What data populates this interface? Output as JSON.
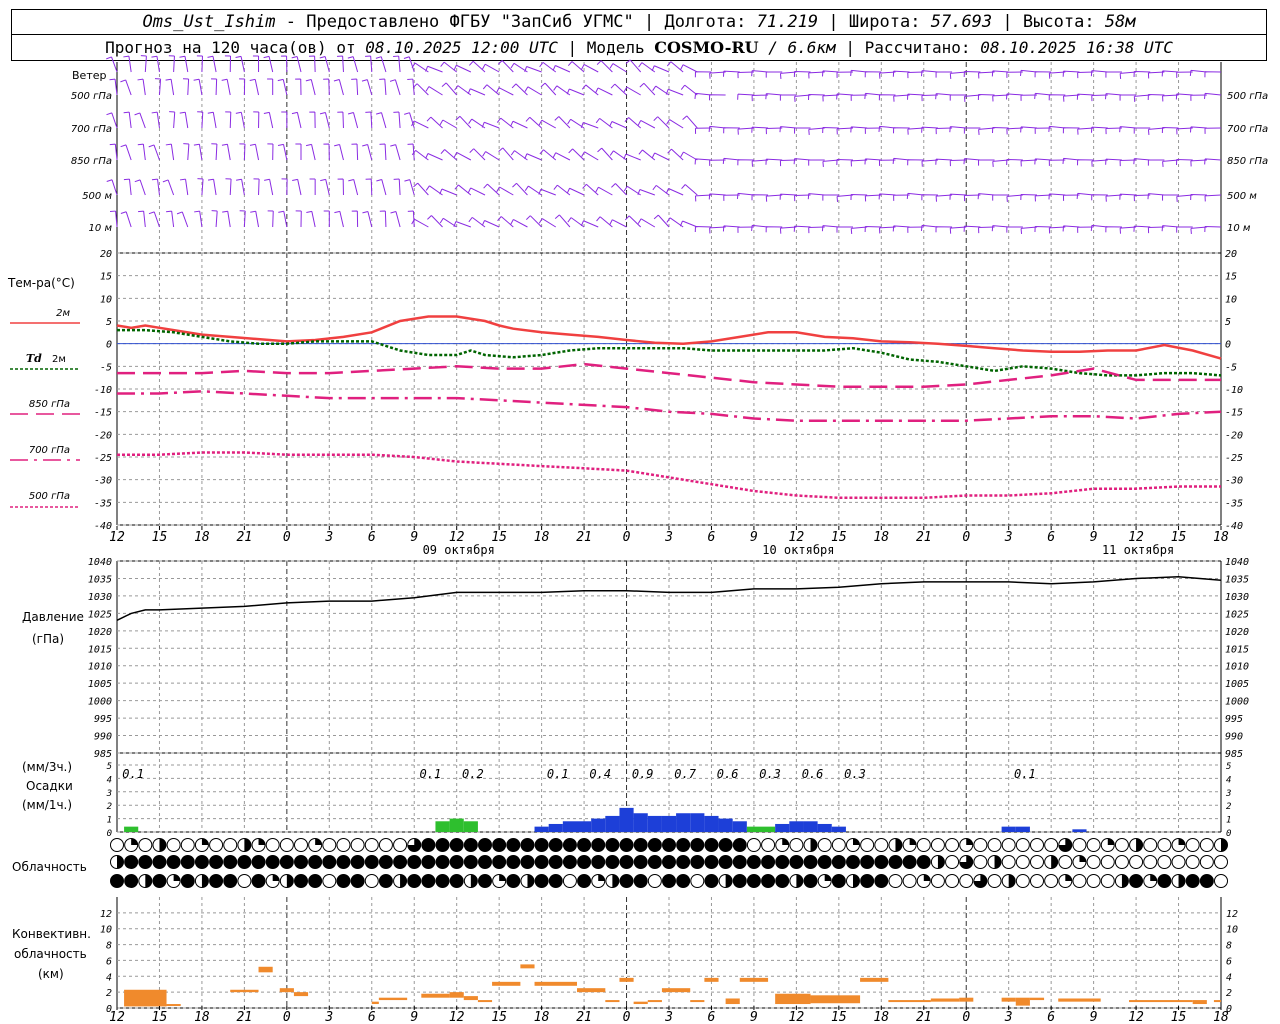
{
  "header": {
    "station": "Oms_Ust_Ishim",
    "provided_by": "- Предоставлено ФГБУ \"ЗапСиб УГМС\"",
    "lon_label": "Долгота:",
    "lon": "71.219",
    "lat_label": "Широта:",
    "lat": "57.693",
    "alt_label": "Высота:",
    "alt": "58м",
    "sep": "|",
    "forecast_label": "Прогноз на 120 часа(ов) от",
    "forecast_start": "08.10.2025 12:00 UTC",
    "model_label": "Модель",
    "model": "COSMO-RU",
    "model_res": "/ 6.6км",
    "calc_label": "Рассчитано:",
    "calc_time": "08.10.2025 16:38 UTC"
  },
  "colors": {
    "wind": "#8a2be2",
    "t2m": "#f04040",
    "td": "#006400",
    "t850": "#e0207f",
    "t700": "#e0207f",
    "t500": "#e0207f",
    "pressure": "#000000",
    "precip_rain": "#1d3fd8",
    "precip_light": "#2ebf2e",
    "convective": "#f08a2c",
    "zero_line": "#3050d0"
  },
  "chart_data": [
    {
      "type": "wind_barbs",
      "title": "Ветер",
      "levels": [
        "500 гПа",
        "700 гПа",
        "850 гПа",
        "500 м",
        "10 м"
      ],
      "x_ticks": [
        "12",
        "15",
        "18",
        "21",
        "0",
        "3",
        "6",
        "9",
        "12",
        "15",
        "18",
        "21",
        "0",
        "3",
        "6",
        "9",
        "12",
        "15",
        "18",
        "21",
        "0",
        "3",
        "6",
        "9",
        "12",
        "15",
        "18"
      ]
    },
    {
      "type": "line",
      "title": "Тем-ра(°С)",
      "ylim": [
        -40,
        20
      ],
      "yticks": [
        20,
        15,
        10,
        5,
        0,
        -5,
        -10,
        -15,
        -20,
        -25,
        -30,
        -35,
        -40
      ],
      "x_hours": [
        0,
        3,
        6,
        9,
        12,
        15,
        18,
        21,
        24,
        27,
        30,
        33,
        36,
        39,
        42,
        45,
        48,
        51,
        54,
        57,
        60,
        63,
        66,
        69,
        72,
        75,
        78
      ],
      "x_ticks": [
        "12",
        "15",
        "18",
        "21",
        "0",
        "3",
        "6",
        "9",
        "12",
        "15",
        "18",
        "21",
        "0",
        "3",
        "6",
        "9",
        "12",
        "15",
        "18",
        "21",
        "0",
        "3",
        "6",
        "9",
        "12",
        "15",
        "18"
      ],
      "day_labels": [
        {
          "hour": 24,
          "text": "09 октября"
        },
        {
          "hour": 48,
          "text": "10 октября"
        },
        {
          "hour": 72,
          "text": "11 октября"
        }
      ],
      "series": [
        {
          "name": "2м",
          "key": "t2m",
          "x": [
            0,
            1,
            2,
            3,
            4,
            6,
            8,
            10,
            12,
            14,
            16,
            18,
            20,
            22,
            24,
            26,
            27,
            28,
            30,
            32,
            34,
            36,
            38,
            40,
            42,
            44,
            46,
            48,
            50,
            52,
            54,
            56,
            58,
            60,
            62,
            64,
            66,
            68,
            70,
            72,
            74,
            76,
            78
          ],
          "values": [
            4,
            3.5,
            4,
            3.5,
            3,
            2,
            1.5,
            1,
            0.5,
            0.8,
            1.5,
            2.5,
            5,
            6,
            6,
            5,
            4,
            3.3,
            2.5,
            2.0,
            1.5,
            0.8,
            0.2,
            0,
            0.5,
            1.5,
            2.5,
            2.5,
            1.5,
            1.2,
            0.5,
            0.3,
            0,
            -0.5,
            -1,
            -1.5,
            -1.8,
            -1.8,
            -1.5,
            -1.5,
            -0.3,
            -1.5,
            -3.3
          ]
        },
        {
          "name": "Td  2м",
          "key": "td",
          "x": [
            0,
            2,
            4,
            6,
            8,
            10,
            12,
            14,
            16,
            18,
            20,
            22,
            24,
            25,
            26,
            28,
            30,
            32,
            34,
            36,
            38,
            40,
            42,
            44,
            46,
            48,
            50,
            52,
            54,
            56,
            58,
            60,
            62,
            64,
            66,
            68,
            70,
            72,
            74,
            76,
            78
          ],
          "values": [
            3,
            3,
            2.5,
            1.5,
            0.5,
            0,
            0,
            0.5,
            0.5,
            0.5,
            -1.5,
            -2.5,
            -2.5,
            -1.5,
            -2.5,
            -3,
            -2.5,
            -1.5,
            -1,
            -1,
            -1,
            -1,
            -1.5,
            -1.5,
            -1.5,
            -1.5,
            -1.5,
            -1,
            -2,
            -3.5,
            -4,
            -5,
            -6,
            -5,
            -5.5,
            -6.5,
            -7,
            -7,
            -6.5,
            -6.5,
            -7
          ]
        },
        {
          "name": "850 гПа",
          "key": "t850",
          "x": [
            0,
            3,
            6,
            9,
            12,
            15,
            18,
            21,
            24,
            27,
            30,
            33,
            36,
            39,
            42,
            45,
            48,
            51,
            54,
            57,
            60,
            63,
            66,
            69,
            72,
            75,
            78
          ],
          "values": [
            -6.5,
            -6.5,
            -6.5,
            -6,
            -6.5,
            -6.5,
            -6,
            -5.5,
            -5,
            -5.5,
            -5.5,
            -4.5,
            -5.5,
            -6.5,
            -7.5,
            -8.5,
            -9,
            -9.5,
            -9.5,
            -9.5,
            -9,
            -8,
            -7,
            -5.5,
            -8,
            -8,
            -8
          ]
        },
        {
          "name": "700 гПа",
          "key": "t700",
          "x": [
            0,
            3,
            6,
            9,
            12,
            15,
            18,
            21,
            24,
            27,
            30,
            33,
            36,
            39,
            42,
            45,
            48,
            51,
            54,
            57,
            60,
            63,
            66,
            69,
            72,
            75,
            78
          ],
          "values": [
            -11,
            -11,
            -10.5,
            -11,
            -11.5,
            -12,
            -12,
            -12,
            -12,
            -12.5,
            -13,
            -13.5,
            -14,
            -15,
            -15.5,
            -16.5,
            -17,
            -17,
            -17,
            -17,
            -17,
            -16.5,
            -16,
            -16,
            -16.5,
            -15.5,
            -15
          ]
        },
        {
          "name": "500 гПа",
          "key": "t500",
          "x": [
            0,
            3,
            6,
            9,
            12,
            15,
            18,
            21,
            24,
            27,
            30,
            33,
            36,
            39,
            42,
            45,
            48,
            51,
            54,
            57,
            60,
            63,
            66,
            69,
            72,
            75,
            78
          ],
          "values": [
            -24.5,
            -24.5,
            -24,
            -24,
            -24.5,
            -24.5,
            -24.5,
            -25,
            -26,
            -26.5,
            -27,
            -27.5,
            -28,
            -29.5,
            -31,
            -32.5,
            -33.5,
            -34,
            -34,
            -34,
            -33.5,
            -33.5,
            -33,
            -32,
            -32,
            -31.5,
            -31.5
          ]
        }
      ]
    },
    {
      "type": "line",
      "title": "Давление",
      "unit": "(гПа)",
      "ylim": [
        985,
        1040
      ],
      "yticks": [
        1040,
        1035,
        1030,
        1025,
        1020,
        1015,
        1010,
        1005,
        1000,
        995,
        990,
        985
      ],
      "series": [
        {
          "key": "pressure",
          "x": [
            0,
            1,
            2,
            3,
            6,
            9,
            12,
            15,
            18,
            21,
            24,
            27,
            30,
            33,
            36,
            39,
            42,
            45,
            48,
            51,
            54,
            57,
            60,
            63,
            66,
            69,
            72,
            75,
            78
          ],
          "values": [
            1023,
            1025,
            1026,
            1026,
            1026.5,
            1027,
            1028,
            1028.5,
            1028.5,
            1029.5,
            1031,
            1031,
            1031,
            1031.5,
            1031.5,
            1031,
            1031,
            1032,
            1032,
            1032.5,
            1033.5,
            1034,
            1034,
            1034,
            1033.5,
            1034,
            1035,
            1035.5,
            1034.5
          ]
        }
      ]
    },
    {
      "type": "bar",
      "title": "Осадки",
      "unit_3h": "(мм/3ч.)",
      "unit_1h": "(мм/1ч.)",
      "ylim": [
        0,
        5
      ],
      "yticks": [
        5,
        4,
        3,
        2,
        1,
        0
      ],
      "totals_3h": [
        {
          "hour": 1,
          "text": "0.1"
        },
        {
          "hour": 22,
          "text": "0.1"
        },
        {
          "hour": 25,
          "text": "0.2"
        },
        {
          "hour": 31,
          "text": "0.1"
        },
        {
          "hour": 34,
          "text": "0.4"
        },
        {
          "hour": 37,
          "text": "0.9"
        },
        {
          "hour": 40,
          "text": "0.7"
        },
        {
          "hour": 43,
          "text": "0.6"
        },
        {
          "hour": 46,
          "text": "0.3"
        },
        {
          "hour": 49,
          "text": "0.6"
        },
        {
          "hour": 52,
          "text": "0.3"
        },
        {
          "hour": 64,
          "text": "0.1"
        }
      ],
      "hourly_light": [
        {
          "hour": 1,
          "value": 0.1
        },
        {
          "hour": 23,
          "value": 0.2
        },
        {
          "hour": 24,
          "value": 0.25
        },
        {
          "hour": 25,
          "value": 0.2
        },
        {
          "hour": 45,
          "value": 0.1
        },
        {
          "hour": 46,
          "value": 0.1
        }
      ],
      "hourly_rain": [
        {
          "hour": 30,
          "value": 0.1
        },
        {
          "hour": 31,
          "value": 0.15
        },
        {
          "hour": 32,
          "value": 0.2
        },
        {
          "hour": 33,
          "value": 0.2
        },
        {
          "hour": 34,
          "value": 0.25
        },
        {
          "hour": 35,
          "value": 0.3
        },
        {
          "hour": 36,
          "value": 0.45
        },
        {
          "hour": 37,
          "value": 0.35
        },
        {
          "hour": 38,
          "value": 0.3
        },
        {
          "hour": 39,
          "value": 0.3
        },
        {
          "hour": 40,
          "value": 0.35
        },
        {
          "hour": 41,
          "value": 0.35
        },
        {
          "hour": 42,
          "value": 0.3
        },
        {
          "hour": 43,
          "value": 0.25
        },
        {
          "hour": 44,
          "value": 0.2
        },
        {
          "hour": 47,
          "value": 0.15
        },
        {
          "hour": 48,
          "value": 0.2
        },
        {
          "hour": 49,
          "value": 0.2
        },
        {
          "hour": 50,
          "value": 0.15
        },
        {
          "hour": 51,
          "value": 0.1
        },
        {
          "hour": 63,
          "value": 0.1
        },
        {
          "hour": 64,
          "value": 0.1
        },
        {
          "hour": 68,
          "value": 0.05
        }
      ]
    },
    {
      "type": "table",
      "title": "Облачность",
      "rows": 3,
      "hourly_cover_description": "cloud cover symbols per hour, upper/middle/lower layers"
    },
    {
      "type": "bar",
      "title": "Конвективн. облачность",
      "unit": "(км)",
      "ylim": [
        0,
        14
      ],
      "yticks": [
        12,
        10,
        8,
        6,
        4,
        2,
        0
      ],
      "segments": [
        {
          "x0": 0.5,
          "x1": 3.5,
          "bottom": 0.2,
          "top": 2.3
        },
        {
          "x0": 3.5,
          "x1": 4.5,
          "bottom": 0.3,
          "top": 0.5
        },
        {
          "x0": 8,
          "x1": 10,
          "bottom": 2.0,
          "top": 2.3
        },
        {
          "x0": 10,
          "x1": 11,
          "bottom": 4.5,
          "top": 5.2
        },
        {
          "x0": 11.5,
          "x1": 12.5,
          "bottom": 2.0,
          "top": 2.5
        },
        {
          "x0": 12.5,
          "x1": 13.5,
          "bottom": 1.5,
          "top": 2.0
        },
        {
          "x0": 18,
          "x1": 18.5,
          "bottom": 0.5,
          "top": 0.8
        },
        {
          "x0": 18.5,
          "x1": 20.5,
          "bottom": 1.0,
          "top": 1.3
        },
        {
          "x0": 21.5,
          "x1": 23.5,
          "bottom": 1.3,
          "top": 1.8
        },
        {
          "x0": 23.5,
          "x1": 24.5,
          "bottom": 1.3,
          "top": 2.0
        },
        {
          "x0": 24.5,
          "x1": 25.5,
          "bottom": 1.0,
          "top": 1.5
        },
        {
          "x0": 25.5,
          "x1": 26.5,
          "bottom": 0.8,
          "top": 1.0
        },
        {
          "x0": 26.5,
          "x1": 28.5,
          "bottom": 2.8,
          "top": 3.3
        },
        {
          "x0": 28.5,
          "x1": 29.5,
          "bottom": 5.0,
          "top": 5.5
        },
        {
          "x0": 29.5,
          "x1": 32.5,
          "bottom": 2.8,
          "top": 3.3
        },
        {
          "x0": 32.5,
          "x1": 34.5,
          "bottom": 2.0,
          "top": 2.5
        },
        {
          "x0": 34.5,
          "x1": 35.5,
          "bottom": 0.8,
          "top": 1.0
        },
        {
          "x0": 35.5,
          "x1": 36.5,
          "bottom": 3.3,
          "top": 3.8
        },
        {
          "x0": 36.5,
          "x1": 37.5,
          "bottom": 0.5,
          "top": 0.8
        },
        {
          "x0": 37.5,
          "x1": 38.5,
          "bottom": 0.8,
          "top": 1.0
        },
        {
          "x0": 38.5,
          "x1": 40.5,
          "bottom": 2.0,
          "top": 2.5
        },
        {
          "x0": 40.5,
          "x1": 41.5,
          "bottom": 0.8,
          "top": 1.0
        },
        {
          "x0": 41.5,
          "x1": 42.5,
          "bottom": 3.3,
          "top": 3.8
        },
        {
          "x0": 43,
          "x1": 44,
          "bottom": 0.5,
          "top": 1.2
        },
        {
          "x0": 44,
          "x1": 46,
          "bottom": 3.3,
          "top": 3.8
        },
        {
          "x0": 46.5,
          "x1": 49,
          "bottom": 0.5,
          "top": 1.8
        },
        {
          "x0": 49,
          "x1": 52.5,
          "bottom": 0.6,
          "top": 1.6
        },
        {
          "x0": 52.5,
          "x1": 54.5,
          "bottom": 3.3,
          "top": 3.8
        },
        {
          "x0": 54.5,
          "x1": 57.5,
          "bottom": 0.8,
          "top": 1.0
        },
        {
          "x0": 57.5,
          "x1": 59.5,
          "bottom": 0.8,
          "top": 1.2
        },
        {
          "x0": 59.5,
          "x1": 60.5,
          "bottom": 0.8,
          "top": 1.3
        },
        {
          "x0": 62.5,
          "x1": 63.5,
          "bottom": 0.8,
          "top": 1.3
        },
        {
          "x0": 63.5,
          "x1": 64.5,
          "bottom": 0.3,
          "top": 1.3
        },
        {
          "x0": 64.5,
          "x1": 65.5,
          "bottom": 1.0,
          "top": 1.3
        },
        {
          "x0": 66.5,
          "x1": 69.5,
          "bottom": 0.8,
          "top": 1.2
        },
        {
          "x0": 71.5,
          "x1": 76,
          "bottom": 0.8,
          "top": 1.0
        },
        {
          "x0": 76,
          "x1": 77,
          "bottom": 0.5,
          "top": 1.0
        },
        {
          "x0": 77.5,
          "x1": 78,
          "bottom": 0.8,
          "top": 1.0
        }
      ]
    }
  ],
  "legend": {
    "wind": "Ветер",
    "temp_title": "Тем-ра(°С)",
    "t2m": "2м",
    "td_italic": "Td",
    "td_rest": "2м",
    "t850": "850 гПа",
    "t700": "700 гПа",
    "t500": "500 гПа",
    "pressure_title": "Давление",
    "pressure_unit": "(гПа)",
    "precip_3h": "(мм/3ч.)",
    "precip_title": "Осадки",
    "precip_1h": "(мм/1ч.)",
    "cloud_title": "Облачность",
    "conv_line1": "Конвективн.",
    "conv_line2": "облачность",
    "conv_unit": "(км)"
  }
}
